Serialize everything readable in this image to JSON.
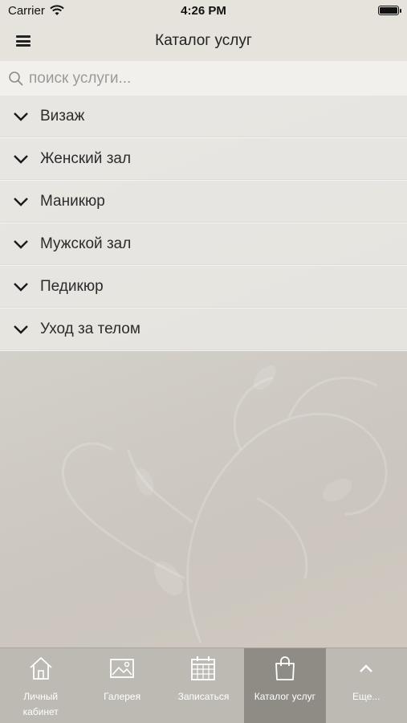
{
  "status_bar": {
    "carrier": "Carrier",
    "time": "4:26 PM",
    "wifi_icon": "wifi-icon",
    "battery_icon": "battery-icon"
  },
  "header": {
    "title": "Каталог услуг",
    "menu_icon": "hamburger-menu-icon"
  },
  "search": {
    "placeholder": "поиск услуги...",
    "value": ""
  },
  "categories": [
    {
      "label": "Визаж"
    },
    {
      "label": "Женский зал"
    },
    {
      "label": "Маникюр"
    },
    {
      "label": "Мужской зал"
    },
    {
      "label": "Педикюр"
    },
    {
      "label": "Уход за телом"
    }
  ],
  "tab_bar": {
    "tabs": [
      {
        "label": "Личный кабинет",
        "icon": "home-icon",
        "active": false
      },
      {
        "label": "Галерея",
        "icon": "image-icon",
        "active": false
      },
      {
        "label": "Записаться",
        "icon": "calendar-icon",
        "active": false
      },
      {
        "label": "Каталог услуг",
        "icon": "shopping-bag-icon",
        "active": true
      },
      {
        "label": "Еще...",
        "icon": "chevron-up-icon",
        "active": false
      }
    ]
  },
  "colors": {
    "header_bg": "#e5e3dc",
    "tab_bar_bg": "#bdbab3",
    "tab_active_bg": "#8f8c85"
  }
}
